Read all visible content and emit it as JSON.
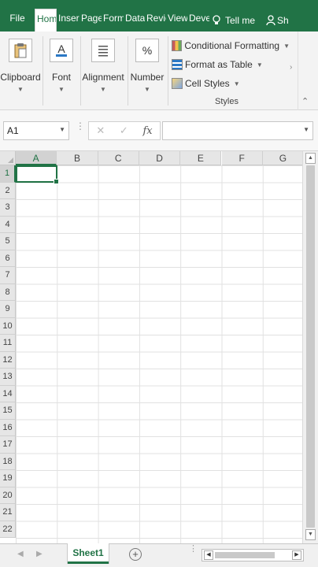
{
  "tabs": [
    {
      "label": "File",
      "cls": "file"
    },
    {
      "label": "Hom",
      "cls": "active"
    },
    {
      "label": "Inser",
      "cls": "w1"
    },
    {
      "label": "Page",
      "cls": "w2"
    },
    {
      "label": "Form",
      "cls": "w3"
    },
    {
      "label": "Data",
      "cls": "w4"
    },
    {
      "label": "Revie",
      "cls": "w5"
    },
    {
      "label": "View",
      "cls": "w6"
    },
    {
      "label": "Deve",
      "cls": "w7"
    }
  ],
  "tell_me": "Tell me",
  "share": "Sh",
  "ribbon": {
    "groups": [
      {
        "label": "Clipboard",
        "icon": "clipboard-icon"
      },
      {
        "label": "Font",
        "icon": "font-color-icon"
      },
      {
        "label": "Alignment",
        "icon": "alignment-icon"
      },
      {
        "label": "Number",
        "icon": "percent-icon"
      }
    ],
    "styles": {
      "conditional_formatting": "Conditional Formatting",
      "format_as_table": "Format as Table",
      "cell_styles": "Cell Styles",
      "group_label": "Styles"
    }
  },
  "formula_bar": {
    "name_box": "A1",
    "formula": ""
  },
  "grid": {
    "columns": [
      "A",
      "B",
      "C",
      "D",
      "E",
      "F",
      "G"
    ],
    "rows": [
      "1",
      "2",
      "3",
      "4",
      "5",
      "6",
      "7",
      "8",
      "9",
      "10",
      "11",
      "12",
      "13",
      "14",
      "15",
      "16",
      "17",
      "18",
      "19",
      "20",
      "21",
      "22"
    ],
    "selected_column": "A",
    "selected_row": "1"
  },
  "sheets": {
    "active": "Sheet1"
  },
  "colors": {
    "brand": "#217346",
    "ribbon_bg": "#f3f3f3",
    "header_bg": "#e6e6e6"
  }
}
